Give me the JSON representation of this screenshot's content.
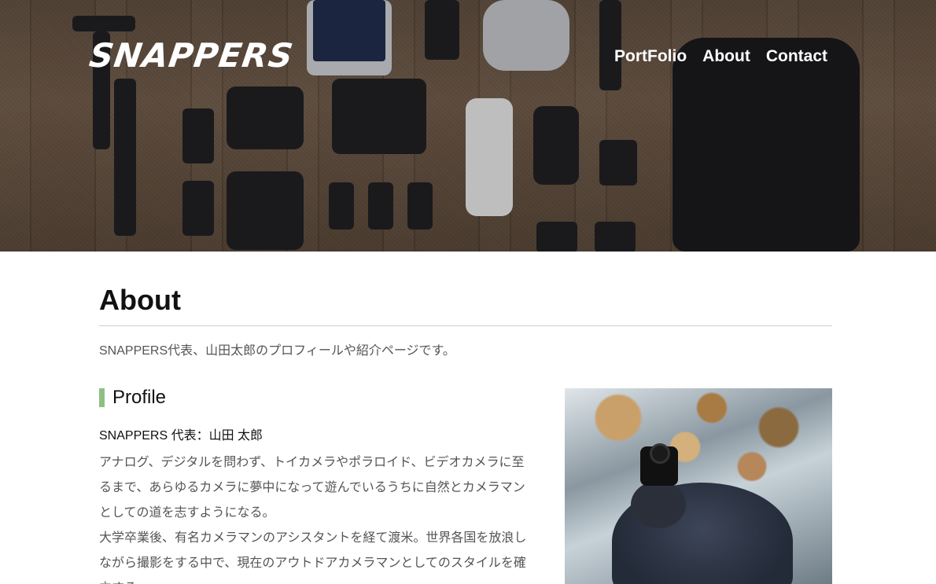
{
  "header": {
    "logo_text": "SNAPPERS",
    "nav": [
      {
        "label": "PortFolio"
      },
      {
        "label": "About"
      },
      {
        "label": "Contact"
      }
    ]
  },
  "main": {
    "title": "About",
    "lead": "SNAPPERS代表、山田太郎のプロフィールや紹介ページです。",
    "profile": {
      "heading": "Profile",
      "name_line": "SNAPPERS 代表：山田 太郎",
      "paragraphs": [
        "アナログ、デジタルを問わず、トイカメラやポラロイド、ビデオカメラに至るまで、あらゆるカメラに夢中になって遊んでいるうちに自然とカメラマンとしての道を志すようになる。",
        "大学卒業後、有名カメラマンのアシスタントを経て渡米。世界各国を放浪しながら撮影をする中で、現在のアウトドアカメラマンとしてのスタイルを確立する。"
      ],
      "accent_color": "#8fbf86"
    }
  },
  "icons": {
    "hero": "camera-gear-flatlay-image",
    "photo": "photographer-on-rocks-image"
  }
}
